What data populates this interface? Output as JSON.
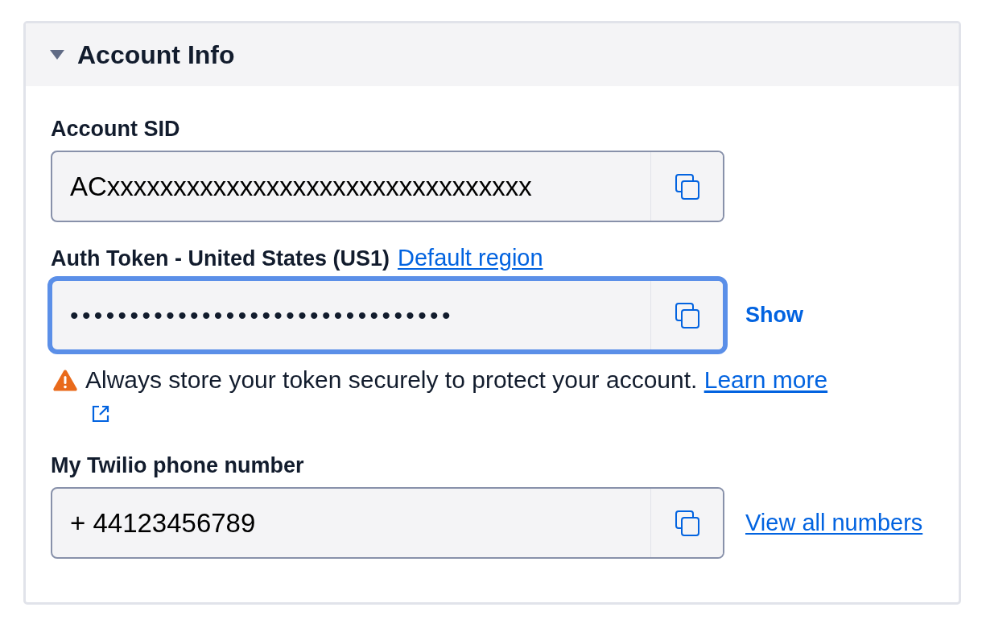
{
  "panel": {
    "title": "Account Info",
    "expanded": true,
    "fields": [
      {
        "kind": "text",
        "label": "Account SID",
        "value": "ACxxxxxxxxxxxxxxxxxxxxxxxxxxxxxxxx",
        "focused": false
      },
      {
        "kind": "password",
        "label": "Auth Token - United States (US1)",
        "label_link": "Default region",
        "value": "••••••••••••••••••••••••••••••••",
        "focused": true,
        "action": {
          "kind": "button",
          "text": "Show"
        },
        "warning": {
          "text": "Always store your token securely to protect your account.",
          "link": "Learn more"
        }
      },
      {
        "kind": "text",
        "label": "My Twilio phone number",
        "value": "+ 44123456789",
        "focused": false,
        "action": {
          "kind": "link",
          "text": "View all numbers"
        }
      }
    ]
  }
}
